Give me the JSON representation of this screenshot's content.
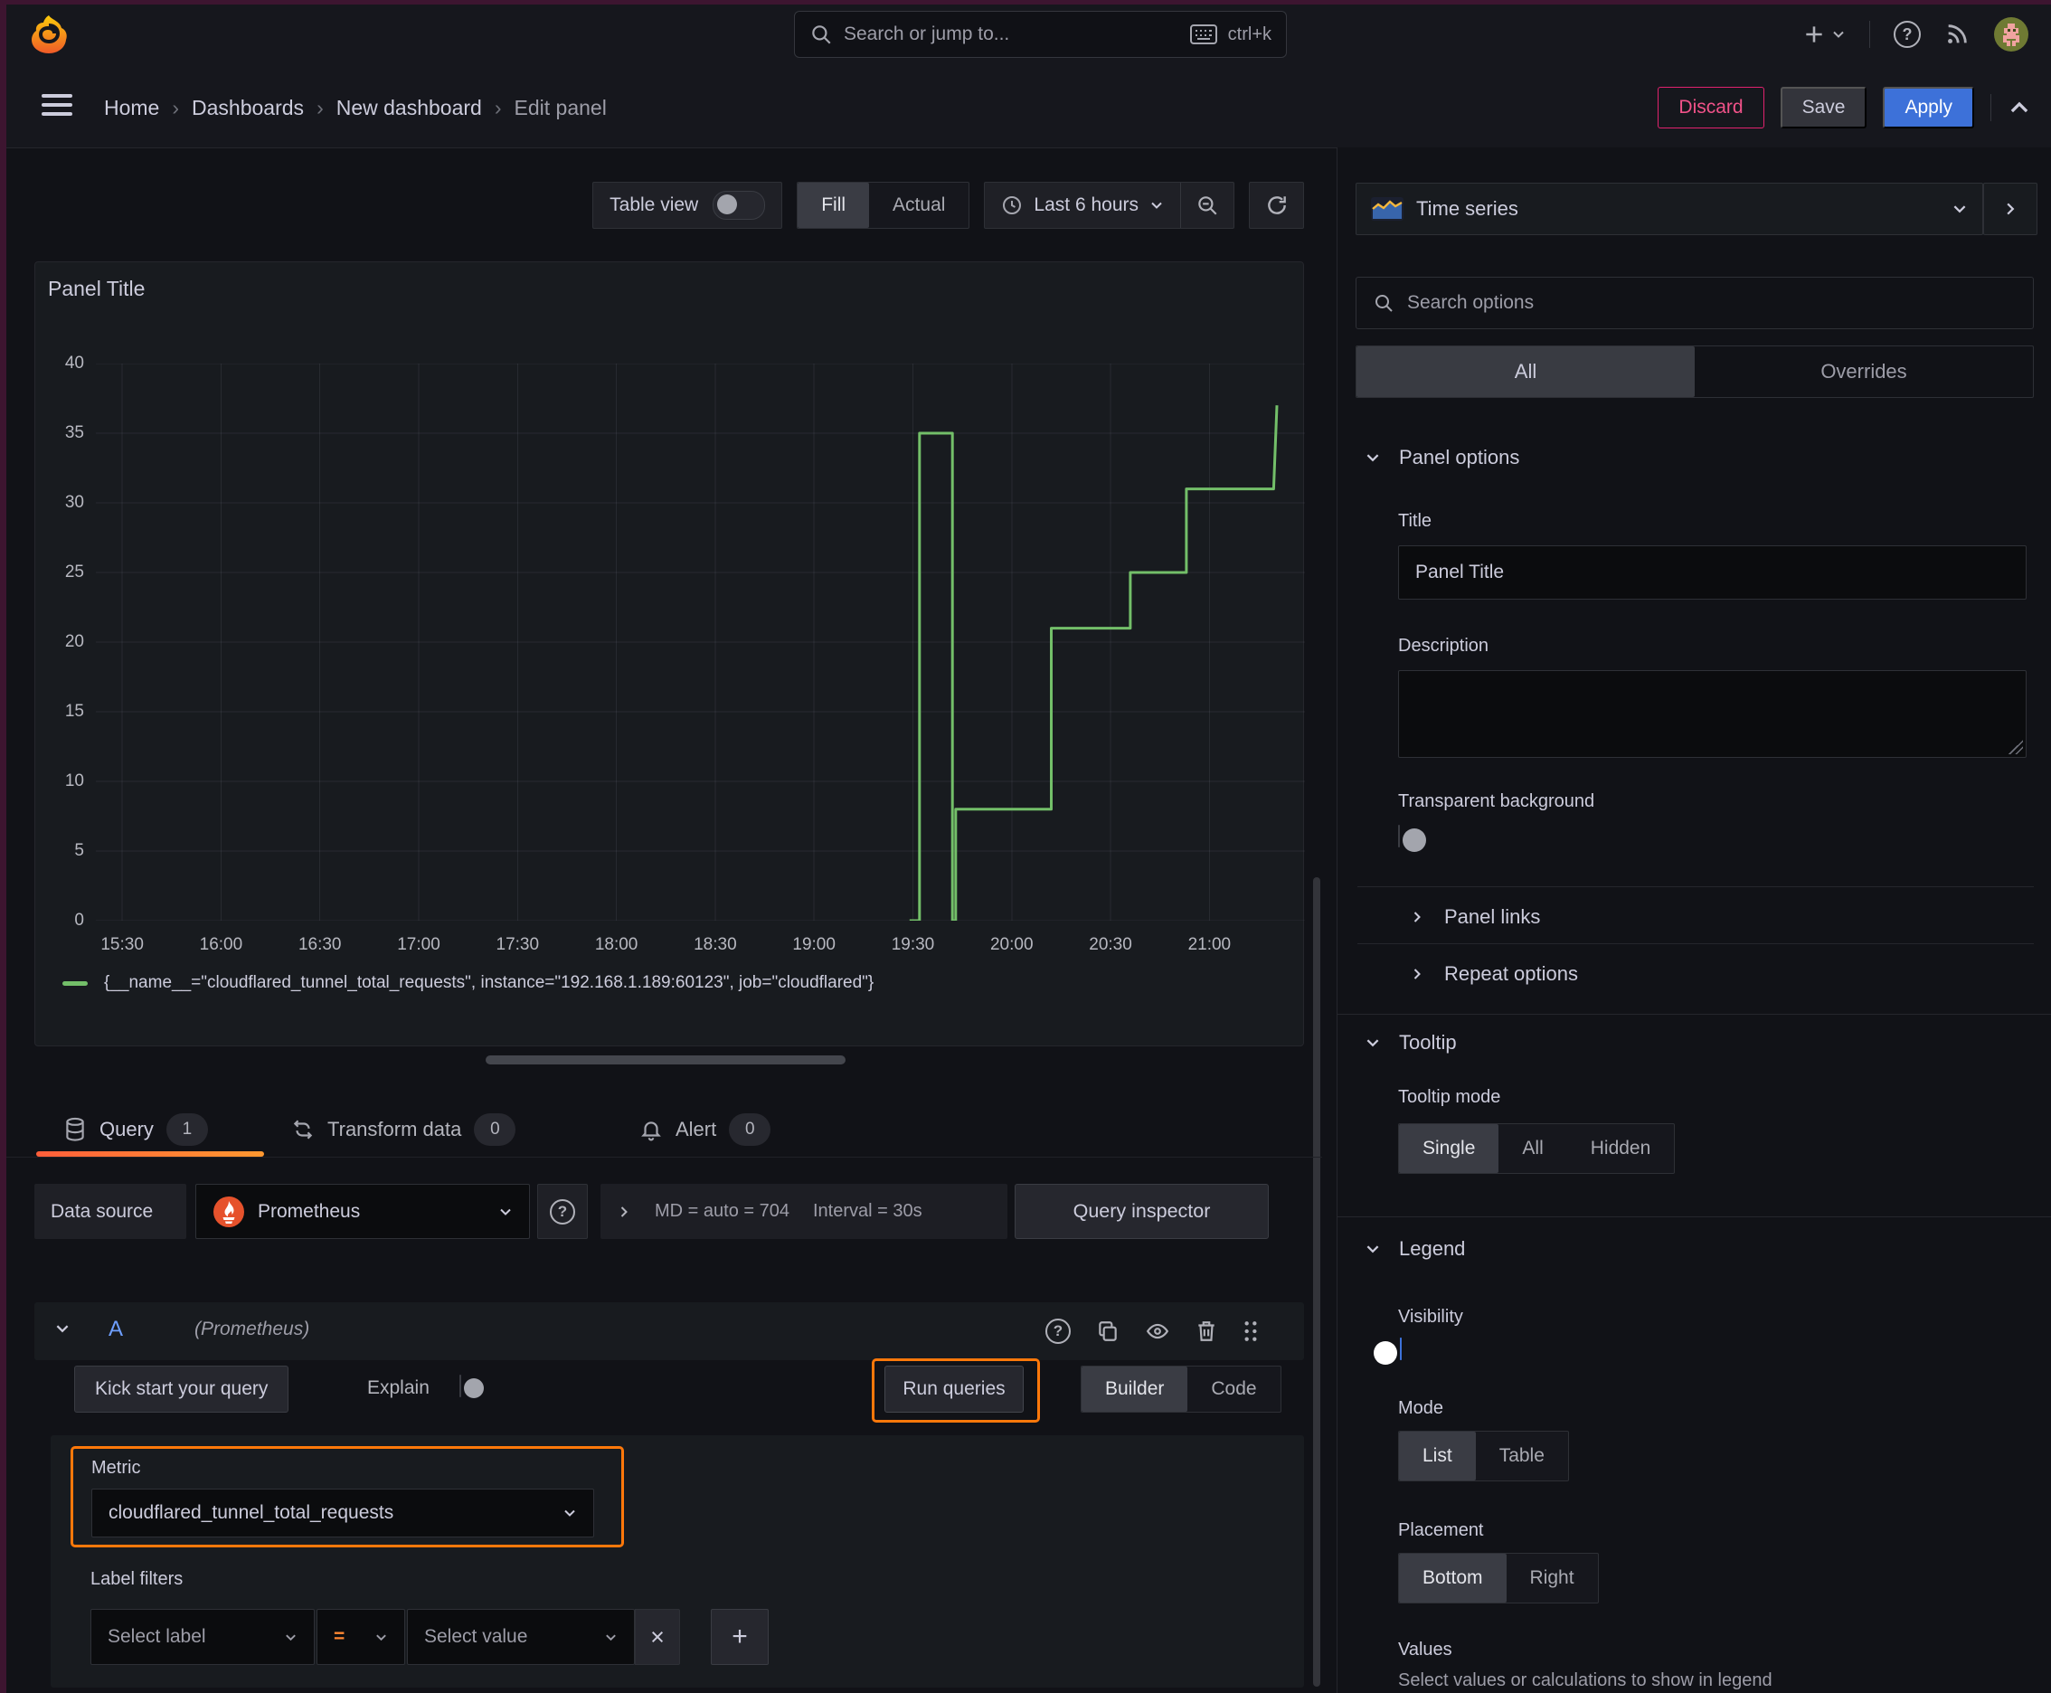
{
  "topbar": {
    "search_placeholder": "Search or jump to...",
    "shortcut": "ctrl+k"
  },
  "breadcrumb": {
    "items": [
      "Home",
      "Dashboards",
      "New dashboard",
      "Edit panel"
    ]
  },
  "actions": {
    "discard": "Discard",
    "save": "Save",
    "apply": "Apply"
  },
  "toolbar": {
    "table_view": "Table view",
    "fill": "Fill",
    "actual": "Actual",
    "time_range": "Last 6 hours"
  },
  "panel": {
    "title": "Panel Title"
  },
  "chart_data": {
    "type": "line",
    "line_style": "step-after",
    "title": "Panel Title",
    "xlabel": "",
    "ylabel": "",
    "ylim": [
      0,
      40
    ],
    "y_ticks": [
      0,
      5,
      10,
      15,
      20,
      25,
      30,
      35,
      40
    ],
    "x_ticks": [
      "15:30",
      "16:00",
      "16:30",
      "17:00",
      "17:30",
      "18:00",
      "18:30",
      "19:00",
      "19:30",
      "20:00",
      "20:30",
      "21:00"
    ],
    "x_domain_minutes_from_1530": [
      -8,
      359
    ],
    "grid": true,
    "legend_position": "bottom",
    "series": [
      {
        "name": "{__name__=\"cloudflared_tunnel_total_requests\", instance=\"192.168.1.189:60123\", job=\"cloudflared\"}",
        "color": "#73bf69",
        "points_minutes_value": [
          [
            239,
            0
          ],
          [
            242,
            0
          ],
          [
            242,
            35
          ],
          [
            252,
            35
          ],
          [
            252,
            0
          ],
          [
            253,
            0
          ],
          [
            253,
            8
          ],
          [
            282,
            8
          ],
          [
            282,
            21
          ],
          [
            306,
            21
          ],
          [
            306,
            25
          ],
          [
            323,
            25
          ],
          [
            323,
            31
          ],
          [
            349.5,
            31
          ],
          [
            350.5,
            37
          ]
        ]
      }
    ]
  },
  "tabs": {
    "query": "Query",
    "query_count": "1",
    "transform": "Transform data",
    "transform_count": "0",
    "alert": "Alert",
    "alert_count": "0"
  },
  "datasource": {
    "label": "Data source",
    "name": "Prometheus",
    "stats_md": "MD = auto = 704",
    "stats_interval": "Interval = 30s",
    "inspector": "Query inspector"
  },
  "query": {
    "ref_id": "A",
    "ds_hint": "(Prometheus)",
    "kick_start": "Kick start your query",
    "explain": "Explain",
    "run_queries": "Run queries",
    "builder": "Builder",
    "code": "Code",
    "metric_label": "Metric",
    "metric_value": "cloudflared_tunnel_total_requests",
    "label_filters": "Label filters",
    "select_label": "Select label",
    "operator": "=",
    "select_value": "Select value",
    "remove": "×",
    "add": "+"
  },
  "sidebar": {
    "viz_name": "Time series",
    "search_placeholder": "Search options",
    "tabs": {
      "all": "All",
      "overrides": "Overrides"
    },
    "panel_options": {
      "heading": "Panel options",
      "title_label": "Title",
      "title_value": "Panel Title",
      "description_label": "Description",
      "transparent_label": "Transparent background"
    },
    "collapsed": {
      "panel_links": "Panel links",
      "repeat_options": "Repeat options"
    },
    "tooltip": {
      "heading": "Tooltip",
      "mode_label": "Tooltip mode",
      "options": [
        "Single",
        "All",
        "Hidden"
      ],
      "selected": "Single"
    },
    "legend": {
      "heading": "Legend",
      "visibility_label": "Visibility",
      "mode_label": "Mode",
      "mode_options": [
        "List",
        "Table"
      ],
      "mode_selected": "List",
      "placement_label": "Placement",
      "placement_options": [
        "Bottom",
        "Right"
      ],
      "placement_selected": "Bottom",
      "values_label": "Values",
      "values_help": "Select values or calculations to show in legend"
    }
  },
  "colors": {
    "accent_blue": "#3d71d9",
    "destructive_pink": "#e0226e",
    "highlight_orange": "#ff780a",
    "series_green": "#73bf69",
    "tab_underline": "#ff7a33"
  }
}
